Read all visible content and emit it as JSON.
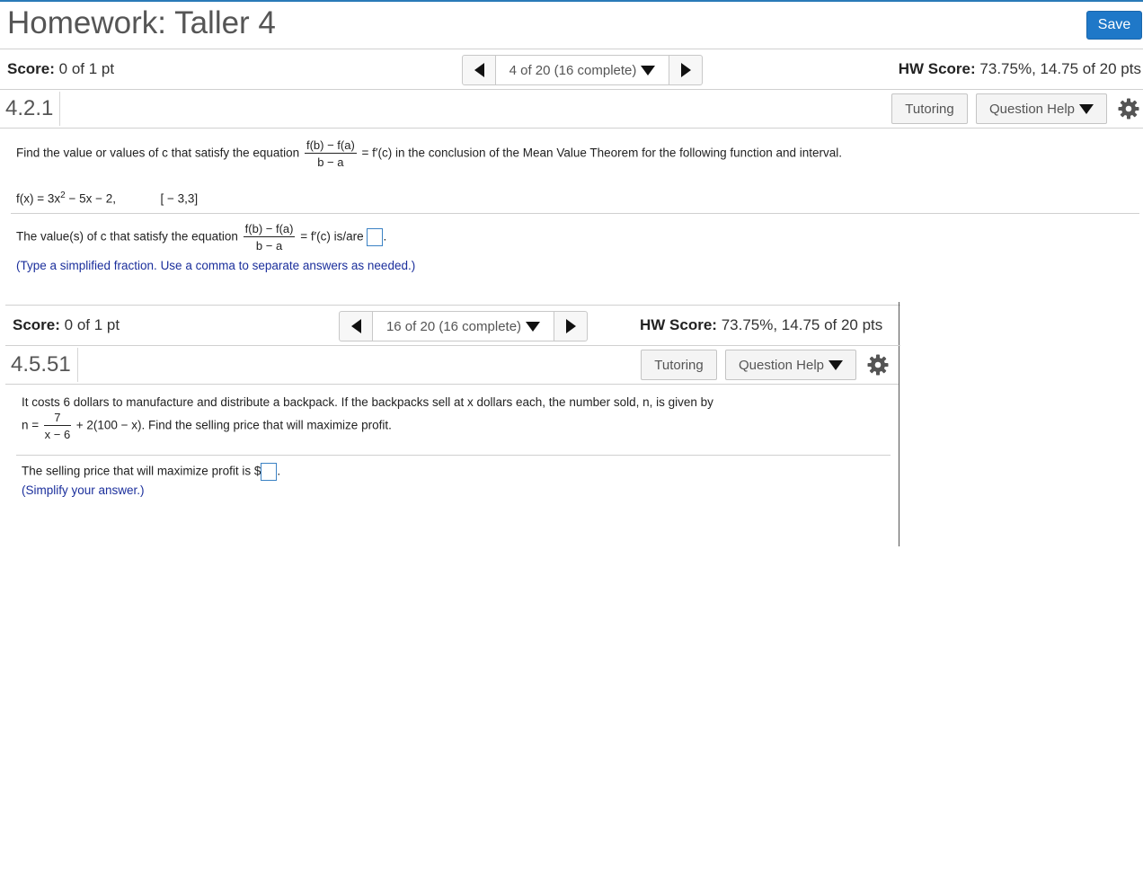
{
  "page": {
    "title": "Homework: Taller 4",
    "save_label": "Save",
    "accent_color": "#1f78c8"
  },
  "q1": {
    "score_label": "Score:",
    "score_value": "0 of 1 pt",
    "nav_label": "4 of 20 (16 complete)",
    "hw_score_label": "HW Score:",
    "hw_score_value": "73.75%, 14.75 of 20 pts",
    "number": "4.2.1",
    "tutoring_label": "Tutoring",
    "help_label": "Question Help",
    "prompt_before": "Find the value or values of c that satisfy the equation",
    "frac_num": "f(b) − f(a)",
    "frac_den": "b − a",
    "prompt_after": "= f′(c) in the conclusion of the Mean Value Theorem for the following function and interval.",
    "function_prefix": "f(x) = 3x",
    "function_exp": "2",
    "function_suffix": " − 5x − 2,",
    "interval": "[ − 3,3]",
    "answer_before": "The value(s) of c that satisfy the equation",
    "answer_after": "= f′(c) is/are",
    "answer_end": ".",
    "hint": "(Type a simplified fraction. Use a comma to separate answers as needed.)"
  },
  "q2": {
    "score_label": "Score:",
    "score_value": "0 of 1 pt",
    "nav_label": "16 of 20 (16 complete)",
    "hw_score_label": "HW Score:",
    "hw_score_value": "73.75%, 14.75 of 20 pts",
    "number": "4.5.51",
    "tutoring_label": "Tutoring",
    "help_label": "Question Help",
    "prompt_line1": "It costs 6 dollars to manufacture and distribute a backpack. If the backpacks sell at x dollars each, the number sold, n, is given by",
    "n_prefix": "n =",
    "frac_num": "7",
    "frac_den": "x − 6",
    "n_suffix": "+ 2(100 − x). Find the selling price that will maximize profit.",
    "answer_before": "The selling price that will maximize profit is $",
    "answer_end": ".",
    "hint": "(Simplify your answer.)"
  }
}
